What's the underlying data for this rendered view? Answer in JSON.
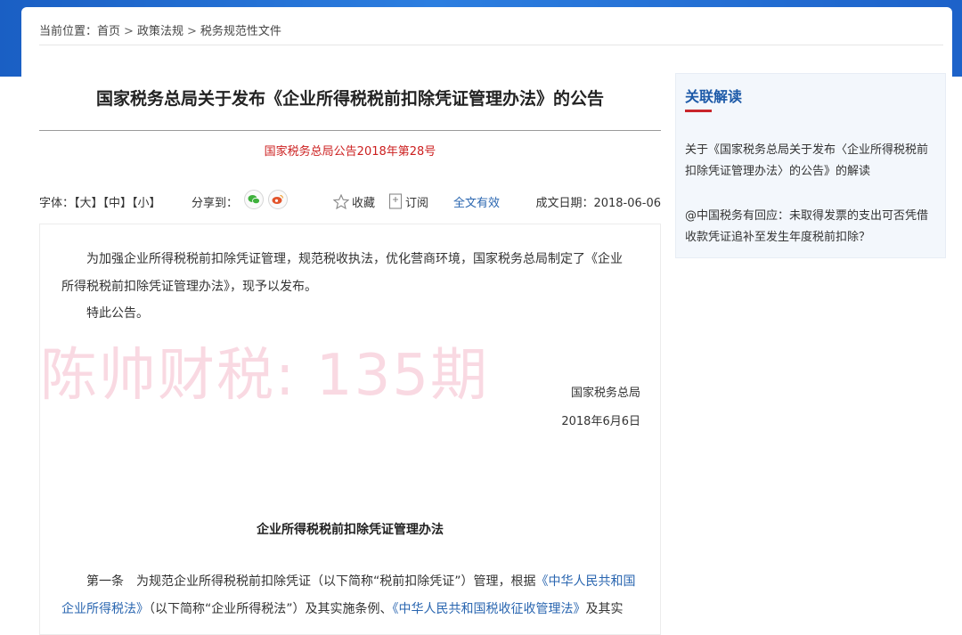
{
  "breadcrumb": {
    "label": "当前位置：",
    "items": [
      "首页",
      "政策法规",
      "税务规范性文件"
    ],
    "separator": ">"
  },
  "article": {
    "title": "国家税务总局关于发布《企业所得税税前扣除凭证管理办法》的公告",
    "doc_number": "国家税务总局公告2018年第28号"
  },
  "toolbar": {
    "font_label": "字体：",
    "font_large": "【大】",
    "font_medium": "【中】",
    "font_small": "【小】",
    "share_label": "分享到：",
    "favorite": "收藏",
    "subscribe": "订阅",
    "validity": "全文有效",
    "date": "成文日期：2018-06-06",
    "icons": {
      "wechat": "wechat-icon",
      "weibo": "weibo-icon",
      "favorite": "star-icon",
      "subscribe": "bookmark-icon"
    },
    "colors": {
      "wechat": "#3fb13c",
      "weibo": "#e2542b",
      "link": "#2a66b0"
    }
  },
  "content": {
    "para1": "为加强企业所得税税前扣除凭证管理，规范税收执法，优化营商环境，国家税务总局制定了《企业所得税税前扣除凭证管理办法》，现予以发布。",
    "para2": "特此公告。",
    "watermark": "陈帅财税: 135期",
    "sign_org": "国家税务总局",
    "sign_date": "2018年6月6日",
    "sub_title": "企业所得税税前扣除凭证管理办法",
    "article1_a": "第一条　为规范企业所得税税前扣除凭证（以下简称“税前扣除凭证”）管理，根据",
    "article1_link1": "《中华人民共和国企业所得税法》",
    "article1_b": "（以下简称“企业所得税法”）及其实施条例、",
    "article1_link2": "《中华人民共和国税收征收管理法》",
    "article1_c": "及其实"
  },
  "sidebar": {
    "title": "关联解读",
    "items": [
      "关于《国家税务总局关于发布〈企业所得税税前扣除凭证管理办法〉的公告》的解读",
      "@中国税务有回应：未取得发票的支出可否凭借收款凭证追补至发生年度税前扣除？"
    ],
    "colors": {
      "title": "#1d5aa8",
      "accent": "#c9252b"
    }
  }
}
